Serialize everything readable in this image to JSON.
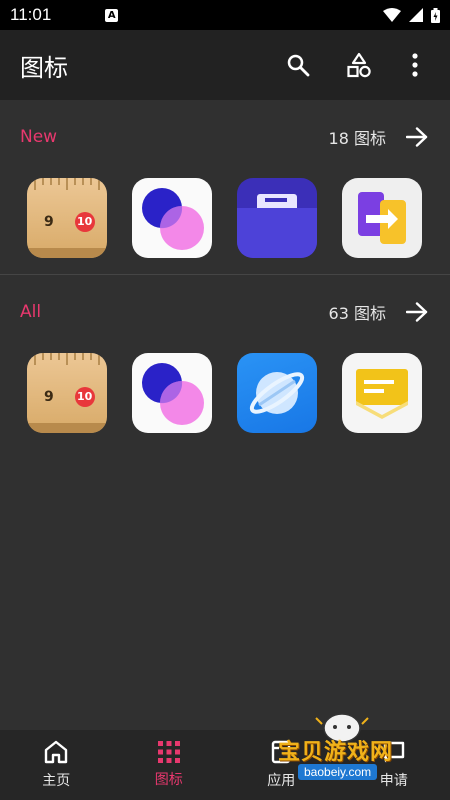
{
  "status_bar": {
    "time": "11:01",
    "notification_glyph": "A"
  },
  "app_bar": {
    "title": "图标"
  },
  "sections": [
    {
      "title": "New",
      "count": "18 图标",
      "icons": [
        "ruler-icon",
        "circles-icon",
        "folder-icon",
        "transfer-icon"
      ]
    },
    {
      "title": "All",
      "count": "63 图标",
      "icons": [
        "ruler-icon",
        "circles-icon",
        "planet-icon",
        "message-icon"
      ]
    }
  ],
  "ruler_numbers": {
    "left": "9",
    "right": "10"
  },
  "bottom_nav": [
    {
      "label": "主页",
      "icon": "home-icon",
      "active": false
    },
    {
      "label": "图标",
      "icon": "grid-icon",
      "active": true
    },
    {
      "label": "应用",
      "icon": "apps-icon",
      "active": false
    },
    {
      "label": "申请",
      "icon": "request-icon",
      "active": false
    }
  ],
  "watermark": {
    "text": "宝贝游戏网",
    "url": "baobeiy.com"
  },
  "colors": {
    "accent": "#e8386e",
    "background": "#303030",
    "app_bar": "#222222",
    "bottom_nav": "#262626"
  }
}
